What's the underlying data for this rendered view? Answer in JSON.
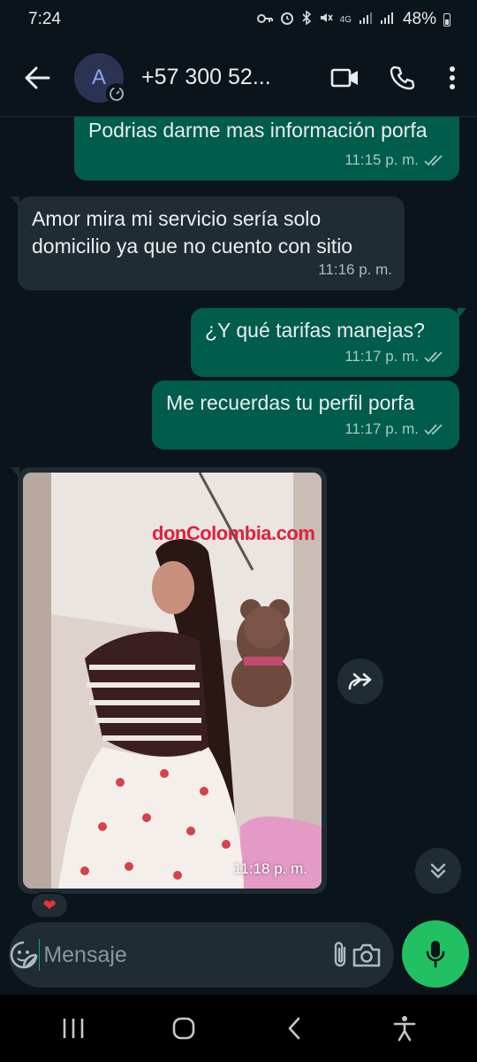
{
  "status_bar": {
    "time": "7:24",
    "battery": "48%",
    "network": "4G"
  },
  "header": {
    "avatar_letter": "A",
    "contact_name": "+57 300 52..."
  },
  "messages": [
    {
      "direction": "out",
      "text": "Podrias darme mas información porfa",
      "time": "11:15 p. m."
    },
    {
      "direction": "in",
      "text": "Amor mira mi servicio sería solo domicilio ya que no cuento con sitio",
      "time": "11:16 p. m."
    },
    {
      "direction": "out",
      "text": "¿Y qué tarifas manejas?",
      "time": "11:17 p. m."
    },
    {
      "direction": "out",
      "text": "Me recuerdas tu perfil porfa",
      "time": "11:17 p. m."
    }
  ],
  "image_message": {
    "direction": "in",
    "time": "11:18 p. m.",
    "watermark": "donColombia.com",
    "reaction": "❤"
  },
  "composer": {
    "placeholder": "Mensaje"
  },
  "colors": {
    "background": "#0b141a",
    "outgoing_bubble": "#005c4b",
    "incoming_bubble": "#202c33",
    "accent_green": "#21c063",
    "ticks": "#a6c9bf"
  }
}
